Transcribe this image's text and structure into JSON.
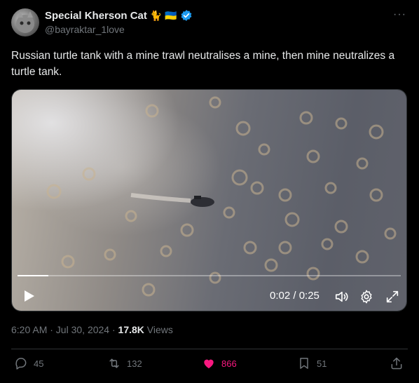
{
  "author": {
    "display_name": "Special Kherson Cat",
    "badges": [
      "🐈",
      "🇺🇦"
    ],
    "handle": "@bayraktar_1love",
    "verified": true
  },
  "tweet": {
    "text": "Russian turtle tank with a mine trawl neutralises a mine, then mine neutralizes a turtle tank."
  },
  "video": {
    "time_label": "0:02 / 0:25",
    "progress": 0.08
  },
  "meta": {
    "timestamp": "6:20 AM · Jul 30, 2024 · ",
    "views_count": "17.8K",
    "views_label": " Views"
  },
  "actions": {
    "replies": "45",
    "reposts": "132",
    "likes": "866",
    "bookmarks": "51"
  },
  "colors": {
    "like": "#f91880",
    "verified": "#1d9bf0",
    "muted": "#71767b"
  }
}
